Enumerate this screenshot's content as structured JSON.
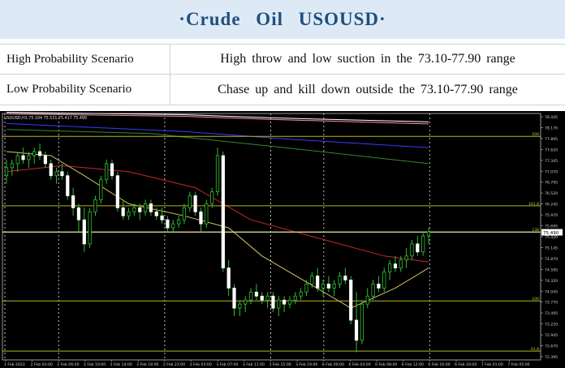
{
  "header": {
    "title": "·Crude Oil USOUSD·"
  },
  "scenarios": [
    {
      "label": "High Probability Scenario",
      "text": "High throw and low suction in the 73.10-77.90 range"
    },
    {
      "label": "Low Probability Scenario",
      "text": "Chase up and kill down outside the 73.10-77.90 range"
    }
  ],
  "chart_data": {
    "type": "candlestick",
    "title": "USOUSD,H1 75.104 75.531 75.417 75.490",
    "ylim": [
      72.31,
      78.45
    ],
    "y_ticks": [
      "78.445",
      "78.170",
      "77.895",
      "77.620",
      "77.345",
      "77.070",
      "76.795",
      "76.520",
      "76.245",
      "75.970",
      "75.695",
      "75.420",
      "75.145",
      "74.870",
      "74.595",
      "74.320",
      "74.045",
      "73.770",
      "73.495",
      "73.220",
      "72.945",
      "72.670",
      "72.395"
    ],
    "x_ticks": [
      "1 Feb 2023",
      "2 Feb 03:00",
      "2 Feb 06:00",
      "2 Feb 10:00",
      "2 Feb 14:00",
      "2 Feb 18:00",
      "2 Feb 23:00",
      "3 Feb 03:00",
      "3 Feb 07:00",
      "3 Feb 11:00",
      "3 Feb 15:00",
      "3 Feb 19:00",
      "6 Feb 00:00",
      "6 Feb 04:00",
      "6 Feb 08:00",
      "6 Feb 12:00",
      "6 Feb 16:00",
      "6 Feb 20:00",
      "7 Feb 01:00",
      "7 Feb 05:00"
    ],
    "current_price": 75.49,
    "horizontal_levels": [
      {
        "label": "200",
        "value": 77.88
      },
      {
        "label": "161.8",
        "value": 76.15
      },
      {
        "label": "138",
        "value": 75.5
      },
      {
        "label": "100",
        "value": 73.78
      },
      {
        "label": "61.8",
        "value": 72.53
      }
    ],
    "vertical_dividers": [
      "1 Feb 2023",
      "2 Feb 06:00",
      "2 Feb 23:00",
      "3 Feb 15:00",
      "6 Feb 00:00",
      "6 Feb 16:00"
    ],
    "candles": [
      [
        76.9,
        77.3,
        76.7,
        77.1
      ],
      [
        77.1,
        77.3,
        76.9,
        77.2
      ],
      [
        77.2,
        77.5,
        77.0,
        77.4
      ],
      [
        77.4,
        77.6,
        77.2,
        77.3
      ],
      [
        77.3,
        77.5,
        77.1,
        77.4
      ],
      [
        77.4,
        77.6,
        77.2,
        77.5
      ],
      [
        77.5,
        77.7,
        77.3,
        77.4
      ],
      [
        77.4,
        77.5,
        77.1,
        77.2
      ],
      [
        77.2,
        77.3,
        76.8,
        76.9
      ],
      [
        76.9,
        77.1,
        76.7,
        77.0
      ],
      [
        77.0,
        77.2,
        76.8,
        76.9
      ],
      [
        76.9,
        77.0,
        76.3,
        76.4
      ],
      [
        76.4,
        76.6,
        75.9,
        76.1
      ],
      [
        76.1,
        76.2,
        75.5,
        75.8
      ],
      [
        75.8,
        76.1,
        75.0,
        75.2
      ],
      [
        75.2,
        76.1,
        75.1,
        76.0
      ],
      [
        76.0,
        76.4,
        75.9,
        76.3
      ],
      [
        76.3,
        76.9,
        76.2,
        76.8
      ],
      [
        76.8,
        77.3,
        76.7,
        77.2
      ],
      [
        77.2,
        77.3,
        76.8,
        76.9
      ],
      [
        76.9,
        77.0,
        76.0,
        76.1
      ],
      [
        76.1,
        76.3,
        75.8,
        75.9
      ],
      [
        75.9,
        76.1,
        75.8,
        76.0
      ],
      [
        76.0,
        76.2,
        75.9,
        76.1
      ],
      [
        76.1,
        76.2,
        75.8,
        76.0
      ],
      [
        76.0,
        76.3,
        75.9,
        76.2
      ],
      [
        76.2,
        76.3,
        75.9,
        76.0
      ],
      [
        76.0,
        76.1,
        75.8,
        75.9
      ],
      [
        75.9,
        76.1,
        75.7,
        75.8
      ],
      [
        75.8,
        75.9,
        75.5,
        75.6
      ],
      [
        75.6,
        75.8,
        75.5,
        75.7
      ],
      [
        75.7,
        75.9,
        75.6,
        75.8
      ],
      [
        75.8,
        76.2,
        75.7,
        76.1
      ],
      [
        76.1,
        76.5,
        76.0,
        76.4
      ],
      [
        76.4,
        76.5,
        75.9,
        76.0
      ],
      [
        76.0,
        76.1,
        75.5,
        75.7
      ],
      [
        75.7,
        76.3,
        75.6,
        76.2
      ],
      [
        76.2,
        76.6,
        76.1,
        76.5
      ],
      [
        76.5,
        77.6,
        76.4,
        77.4
      ],
      [
        77.4,
        77.5,
        74.5,
        74.6
      ],
      [
        74.6,
        74.8,
        73.9,
        74.1
      ],
      [
        74.1,
        74.2,
        73.4,
        73.6
      ],
      [
        73.6,
        73.8,
        73.4,
        73.7
      ],
      [
        73.7,
        73.9,
        73.5,
        73.8
      ],
      [
        73.8,
        74.1,
        73.7,
        74.0
      ],
      [
        74.0,
        74.2,
        73.8,
        73.9
      ],
      [
        73.9,
        74.0,
        73.7,
        73.8
      ],
      [
        73.8,
        74.0,
        73.6,
        73.9
      ],
      [
        73.9,
        74.0,
        73.5,
        73.6
      ],
      [
        73.6,
        73.9,
        73.4,
        73.8
      ],
      [
        73.8,
        73.9,
        73.5,
        73.7
      ],
      [
        73.7,
        73.9,
        73.6,
        73.8
      ],
      [
        73.8,
        74.0,
        73.7,
        73.9
      ],
      [
        73.9,
        74.1,
        73.8,
        74.0
      ],
      [
        74.0,
        74.3,
        73.9,
        74.2
      ],
      [
        74.2,
        74.5,
        74.1,
        74.4
      ],
      [
        74.4,
        74.6,
        74.0,
        74.1
      ],
      [
        74.1,
        74.3,
        73.9,
        74.2
      ],
      [
        74.2,
        74.4,
        74.0,
        74.1
      ],
      [
        74.1,
        74.3,
        73.9,
        74.2
      ],
      [
        74.2,
        74.5,
        74.1,
        74.4
      ],
      [
        74.4,
        74.6,
        74.2,
        74.3
      ],
      [
        74.3,
        74.4,
        73.2,
        73.3
      ],
      [
        73.3,
        74.0,
        72.5,
        72.8
      ],
      [
        72.8,
        73.8,
        72.7,
        73.7
      ],
      [
        73.7,
        74.1,
        73.6,
        73.9
      ],
      [
        73.9,
        74.3,
        73.8,
        74.2
      ],
      [
        74.2,
        74.4,
        74.0,
        74.1
      ],
      [
        74.1,
        74.6,
        74.0,
        74.5
      ],
      [
        74.5,
        74.8,
        74.3,
        74.7
      ],
      [
        74.7,
        74.9,
        74.5,
        74.6
      ],
      [
        74.6,
        74.9,
        74.5,
        74.8
      ],
      [
        74.8,
        75.1,
        74.6,
        74.9
      ],
      [
        74.9,
        75.3,
        74.8,
        75.2
      ],
      [
        75.2,
        75.4,
        74.9,
        75.0
      ],
      [
        75.0,
        75.5,
        74.9,
        75.4
      ],
      [
        75.4,
        75.6,
        75.2,
        75.5
      ]
    ],
    "moving_averages": [
      {
        "color": "#ffffff",
        "points": [
          [
            0,
            78.48
          ],
          [
            32,
            78.42
          ],
          [
            48,
            78.34
          ],
          [
            76,
            78.24
          ]
        ]
      },
      {
        "color": "#ff8ea0",
        "points": [
          [
            0,
            78.44
          ],
          [
            32,
            78.38
          ],
          [
            48,
            78.3
          ],
          [
            76,
            78.19
          ]
        ]
      },
      {
        "color": "#3a3aff",
        "points": [
          [
            0,
            78.2
          ],
          [
            32,
            78.0
          ],
          [
            52,
            77.8
          ],
          [
            76,
            77.6
          ]
        ]
      },
      {
        "color": "#2e8b2e",
        "points": [
          [
            0,
            78.05
          ],
          [
            26,
            77.95
          ],
          [
            50,
            77.6
          ],
          [
            76,
            77.2
          ]
        ]
      },
      {
        "color": "#c62828",
        "points": [
          [
            0,
            77.0
          ],
          [
            10,
            77.15
          ],
          [
            22,
            77.0
          ],
          [
            34,
            76.6
          ],
          [
            44,
            75.8
          ],
          [
            56,
            75.35
          ],
          [
            68,
            74.9
          ],
          [
            76,
            74.75
          ]
        ]
      },
      {
        "color": "#d4c26a",
        "points": [
          [
            0,
            77.5
          ],
          [
            8,
            77.4
          ],
          [
            14,
            76.9
          ],
          [
            22,
            76.2
          ],
          [
            32,
            75.9
          ],
          [
            40,
            75.6
          ],
          [
            46,
            74.9
          ],
          [
            54,
            74.25
          ],
          [
            62,
            73.6
          ],
          [
            70,
            74.1
          ],
          [
            76,
            74.6
          ]
        ]
      }
    ]
  }
}
